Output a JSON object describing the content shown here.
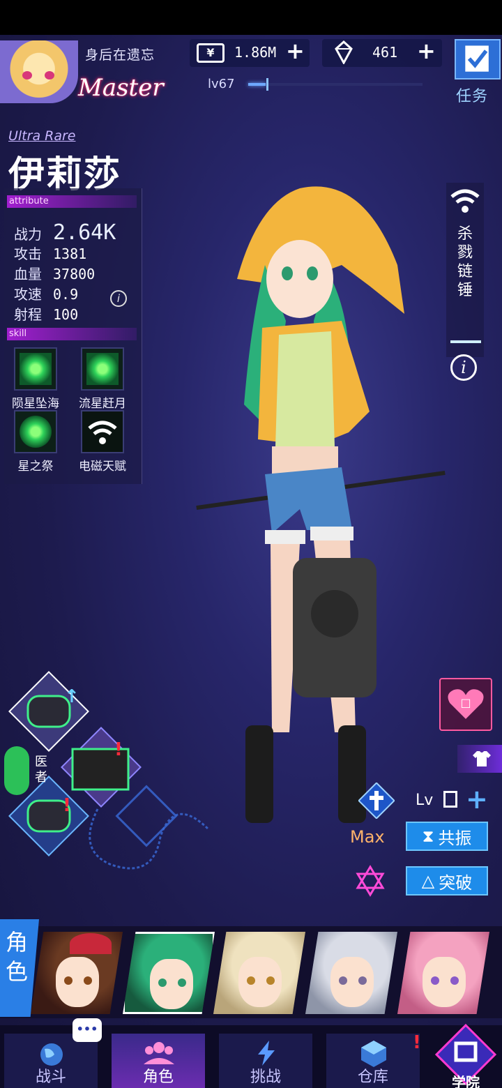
{
  "header": {
    "player_name": "身后在遗忘",
    "rank": "Master",
    "level": "lv67",
    "level_progress": 0.1,
    "money": {
      "icon_text": "¥",
      "value": "1.86M"
    },
    "gems": {
      "value": "461"
    },
    "task_label": "任务"
  },
  "character": {
    "rarity": "Ultra Rare",
    "name": "伊莉莎",
    "attribute_header": "attribute",
    "skill_header": "skill",
    "stats": [
      {
        "key": "战力",
        "value": "2.64K"
      },
      {
        "key": "攻击",
        "value": "1381"
      },
      {
        "key": "血量",
        "value": "37800"
      },
      {
        "key": "攻速",
        "value": "0.9"
      },
      {
        "key": "射程",
        "value": "100"
      }
    ],
    "skills": [
      "陨星坠海",
      "流星赶月",
      "星之祭",
      "电磁天赋"
    ],
    "weapon_name": [
      "杀",
      "戮",
      "链",
      "锤"
    ],
    "info_glyph": "i"
  },
  "upgrade": {
    "lv_label": "Lv",
    "max_label": "Max",
    "resonance": "共振",
    "breakthrough": "突破",
    "role_label": "医者",
    "affection_value": "□"
  },
  "strip": {
    "label_chars": [
      "角",
      "色"
    ]
  },
  "nav": {
    "items": [
      "战斗",
      "角色",
      "挑战",
      "仓库",
      "学院"
    ],
    "chat_glyph": "•••"
  },
  "colors": {
    "accent": "#1e8cea",
    "rank_glow": "#ff2e6e",
    "skill_green": "#2fd35a"
  }
}
